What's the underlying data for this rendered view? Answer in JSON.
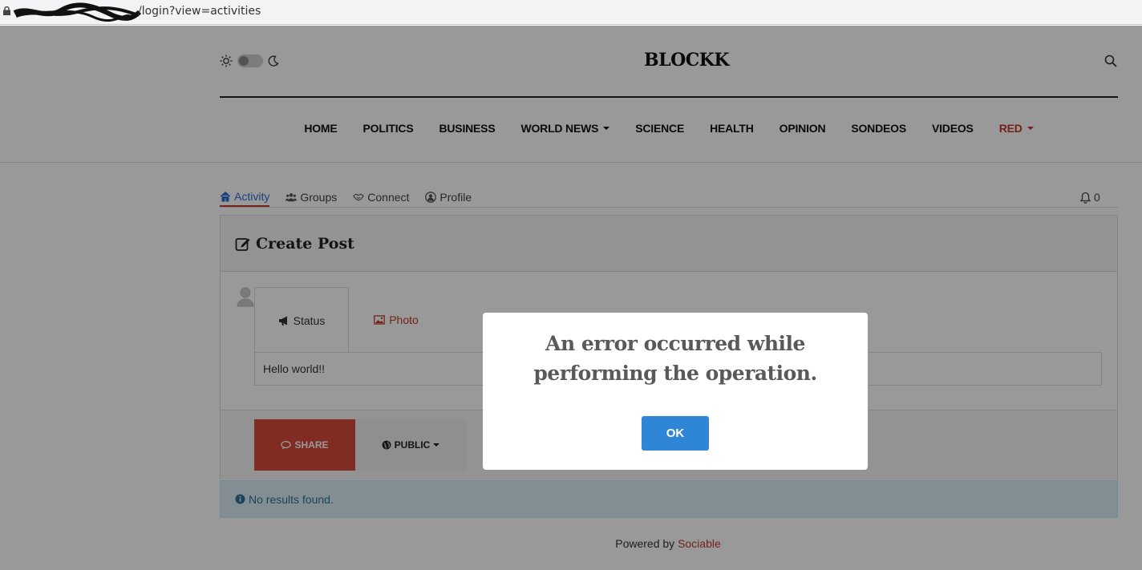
{
  "browser": {
    "url": "/login?view=activities"
  },
  "header": {
    "brand": "BLOCKK",
    "nav": [
      {
        "label": "HOME"
      },
      {
        "label": "POLITICS"
      },
      {
        "label": "BUSINESS"
      },
      {
        "label": "WORLD NEWS"
      },
      {
        "label": "SCIENCE"
      },
      {
        "label": "HEALTH"
      },
      {
        "label": "OPINION"
      },
      {
        "label": "SONDEOS"
      },
      {
        "label": "VIDEOS"
      },
      {
        "label": "RED"
      }
    ]
  },
  "tabs": {
    "activity": "Activity",
    "groups": "Groups",
    "connect": "Connect",
    "profile": "Profile",
    "notification_count": "0"
  },
  "post": {
    "title": "Create Post",
    "tabs": {
      "status": "Status",
      "photo": "Photo"
    },
    "content": "Hello world!!",
    "share": "SHARE",
    "visibility": "PUBLIC"
  },
  "alert": {
    "text": "No results found."
  },
  "footer": {
    "powered_by": "Powered by",
    "link": "Sociable"
  },
  "modal": {
    "message": "An error occurred while performing the operation.",
    "ok": "OK"
  },
  "colors": {
    "accent_red": "#c0392b",
    "link_blue": "#2e6bd1",
    "ok_button": "#2f86d6",
    "share_button": "#d74a3a"
  }
}
